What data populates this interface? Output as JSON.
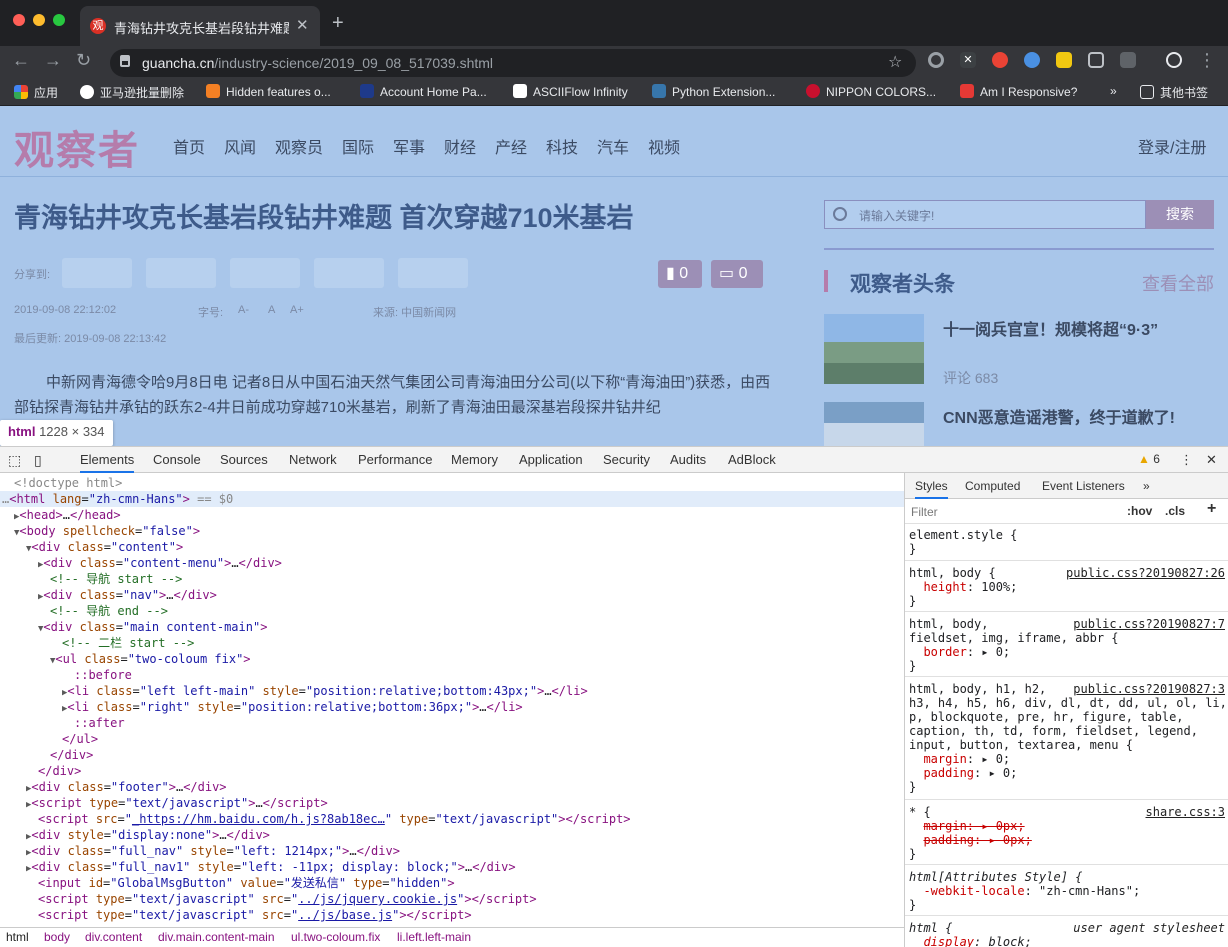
{
  "window": {
    "tab_title": "青海钻井攻克长基岩段钻井难题",
    "tab_favicon": "观",
    "url_domain": "guancha.cn",
    "url_path": "/industry-science/2019_09_08_517039.shtml"
  },
  "bookmarks": [
    {
      "label": "应用",
      "color": "#ea4335"
    },
    {
      "label": "亚马逊批量删除",
      "color": "#ffffff"
    },
    {
      "label": "Hidden features o...",
      "color": "#f48024"
    },
    {
      "label": "Account Home Pa...",
      "color": "#1e3a8a"
    },
    {
      "label": "ASCIIFlow Infinity",
      "color": "#ffffff"
    },
    {
      "label": "Python Extension...",
      "color": "#3776ab"
    },
    {
      "label": "NIPPON COLORS...",
      "color": "#c8102e"
    },
    {
      "label": "Am I Responsive?",
      "color": "#e53935"
    }
  ],
  "bookmarks_overflow": "»",
  "other_bookmarks": "其他书签",
  "site": {
    "logo": "观察者",
    "nav": [
      "首页",
      "风闻",
      "观察员",
      "国际",
      "军事",
      "财经",
      "产经",
      "科技",
      "汽车",
      "视频"
    ],
    "login": "登录/注册",
    "headline": "青海钻井攻克长基岩段钻井难题 首次穿越710米基岩",
    "share_label": "分享到:",
    "bookmark_count": "0",
    "comment_count": "0",
    "date": "2019-09-08 22:12:02",
    "font_label": "字号:",
    "font_sizes": [
      "A-",
      "A",
      "A+"
    ],
    "source": "来源:  中国新闻网",
    "updated": "最后更新: 2019-09-08 22:13:42",
    "body": "中新网青海德令哈9月8日电 记者8日从中国石油天然气集团公司青海油田分公司(以下称“青海油田”)获悉，由西部钻探青海钻井承钻的跃东2-4井日前成功穿越710米基岩，刷新了青海油田最深基岩段探井钻井纪",
    "search_placeholder": "请输入关键字!",
    "search_button": "搜索",
    "sidebar_title": "观察者头条",
    "sidebar_all": "查看全部",
    "news": [
      {
        "title": "十一阅兵官宣！规模将超“9·3”"
      },
      {
        "title": "CNN恶意造谣港警，终于道歉了!"
      }
    ],
    "comment_label": "评论 683",
    "inspect_tag": "html",
    "inspect_size": "1228 × 334"
  },
  "devtools": {
    "tabs": [
      "Elements",
      "Console",
      "Sources",
      "Network",
      "Performance",
      "Memory",
      "Application",
      "Security",
      "Audits",
      "AdBlock"
    ],
    "warnings": "6",
    "breadcrumbs": [
      "html",
      "body",
      "div.content",
      "div.main.content-main",
      "ul.two-coloum.fix",
      "li.left.left-main"
    ],
    "style_tabs": [
      "Styles",
      "Computed",
      "Event Listeners",
      "»"
    ],
    "filter_placeholder": "Filter",
    "hov": ":hov",
    "cls": ".cls",
    "plus": "+"
  },
  "colors": {
    "page_overlay": "#a9c6ea",
    "accent": "#b57cab",
    "devtools_blue": "#1a73e8"
  }
}
